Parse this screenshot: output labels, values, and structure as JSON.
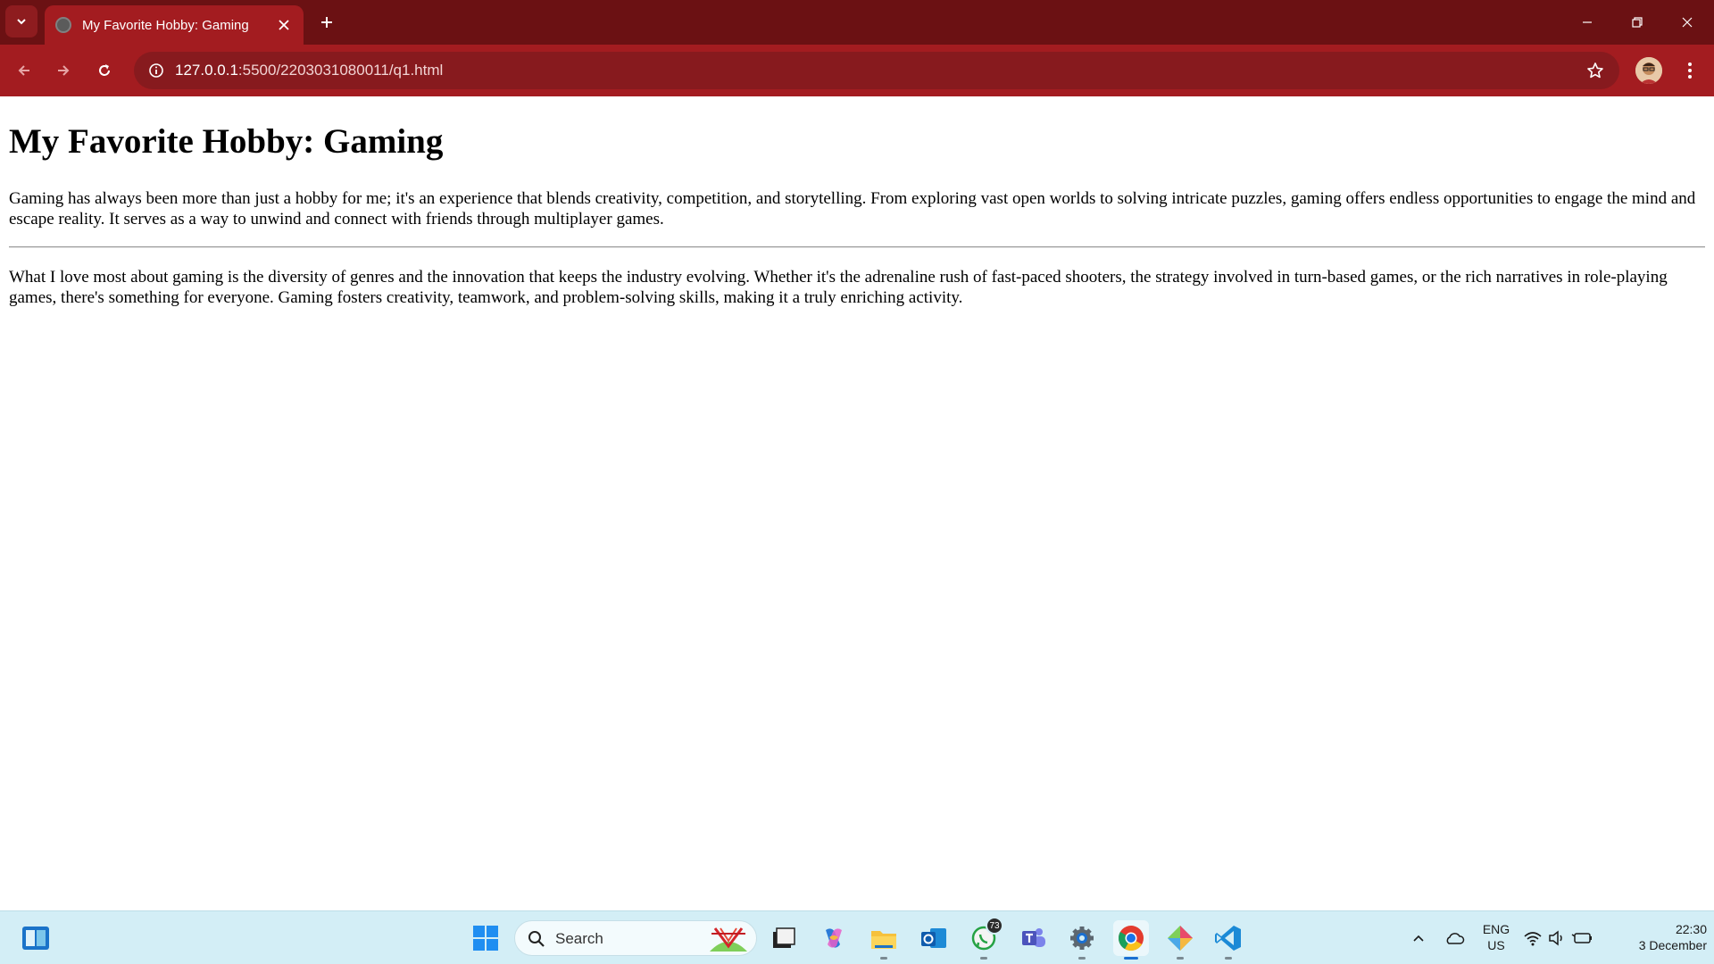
{
  "browser": {
    "tab_title": "My Favorite Hobby: Gaming",
    "url_host": "127.0.0.1",
    "url_path": ":5500/2203031080011/q1.html"
  },
  "page": {
    "heading": "My Favorite Hobby: Gaming",
    "paragraph_1": "Gaming has always been more than just a hobby for me; it's an experience that blends creativity, competition, and storytelling. From exploring vast open worlds to solving intricate puzzles, gaming offers endless opportunities to engage the mind and escape reality. It serves as a way to unwind and connect with friends through multiplayer games.",
    "paragraph_2": "What I love most about gaming is the diversity of genres and the innovation that keeps the industry evolving. Whether it's the adrenaline rush of fast-paced shooters, the strategy involved in turn-based games, or the rich narratives in role-playing games, there's something for everyone. Gaming fosters creativity, teamwork, and problem-solving skills, making it a truly enriching activity."
  },
  "taskbar": {
    "search_label": "Search",
    "whatsapp_badge": "73",
    "lang_line1": "ENG",
    "lang_line2": "US",
    "time": "22:30",
    "date": "3 December"
  },
  "colors": {
    "tabbar": "#6b1113",
    "toolbar": "#a31c20",
    "taskbar": "#d3eef6"
  }
}
